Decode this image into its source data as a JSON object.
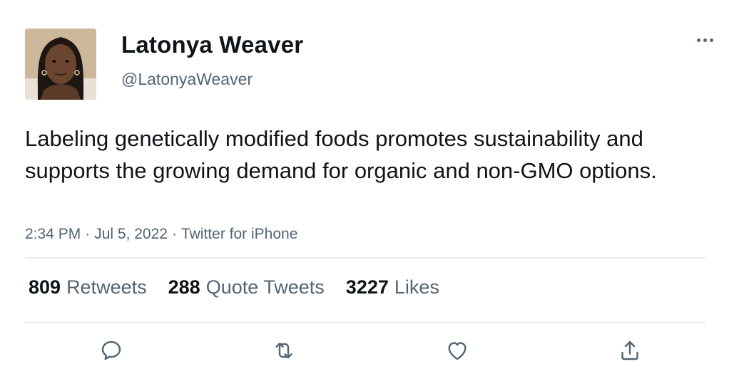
{
  "tweet": {
    "author": {
      "display_name": "Latonya Weaver",
      "handle": "@LatonyaWeaver"
    },
    "text": "Labeling genetically modified foods promotes sustainability and supports the growing demand for organic and non-GMO options.",
    "time": "2:34 PM",
    "date": "Jul 5, 2022",
    "source": "Twitter for iPhone",
    "separator": "·"
  },
  "stats": [
    {
      "count": "809",
      "label": "Retweets"
    },
    {
      "count": "288",
      "label": "Quote Tweets"
    },
    {
      "count": "3227",
      "label": "Likes"
    }
  ],
  "icons": {
    "more": "more-horizontal-icon",
    "reply": "reply-icon",
    "retweet": "retweet-icon",
    "like": "heart-icon",
    "share": "share-icon"
  },
  "colors": {
    "text_primary": "#0f1419",
    "text_secondary": "#536471",
    "divider": "#e6e9ec"
  }
}
